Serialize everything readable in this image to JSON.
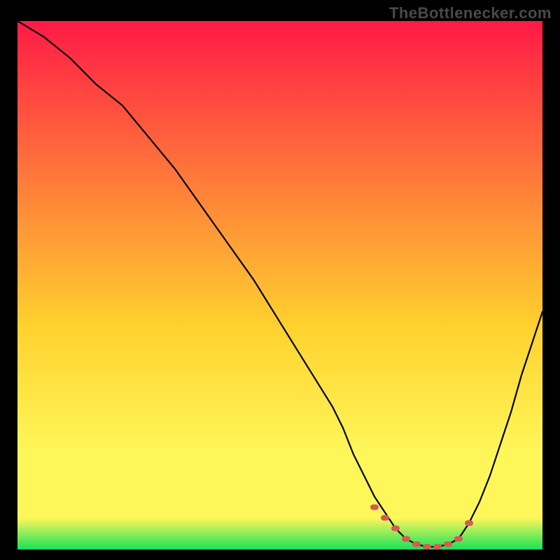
{
  "watermark": "TheBottlenecker.com",
  "colors": {
    "bg": "#000000",
    "gradient_top": "#ff1a46",
    "gradient_mid1": "#ff7a3a",
    "gradient_mid2": "#ffd22e",
    "gradient_mid3": "#fff75a",
    "gradient_bottom": "#18e258",
    "curve": "#000000",
    "marker": "#d85a58"
  },
  "chart_data": {
    "type": "line",
    "title": "",
    "xlabel": "",
    "ylabel": "",
    "xlim": [
      0,
      100
    ],
    "ylim": [
      0,
      100
    ],
    "series": [
      {
        "name": "bottleneck-curve",
        "x": [
          0,
          5,
          10,
          15,
          20,
          25,
          30,
          35,
          40,
          45,
          50,
          55,
          60,
          62,
          64,
          66,
          68,
          70,
          72,
          74,
          76,
          78,
          80,
          82,
          84,
          86,
          88,
          90,
          92,
          94,
          96,
          98,
          100
        ],
        "values": [
          100,
          97,
          93,
          88,
          84,
          78,
          72,
          65,
          58,
          51,
          43,
          35,
          27,
          23,
          18,
          14,
          10,
          7,
          4,
          2,
          1,
          0.5,
          0.5,
          1,
          2,
          5,
          9,
          14,
          20,
          26,
          33,
          39,
          45
        ]
      }
    ],
    "markers": {
      "name": "optimal-zone",
      "x": [
        68,
        70,
        72,
        74,
        76,
        78,
        80,
        82,
        84,
        86
      ],
      "values": [
        8,
        6,
        4,
        2,
        1,
        0.5,
        0.5,
        1,
        2,
        5
      ]
    }
  }
}
